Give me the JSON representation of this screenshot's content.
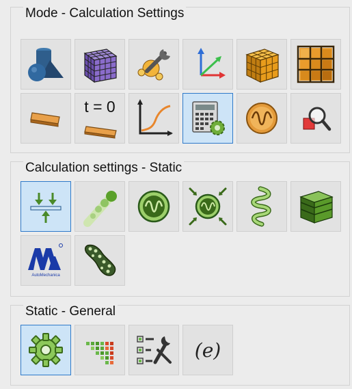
{
  "groups": [
    {
      "title": "Mode - Calculation Settings",
      "buttons": [
        {
          "name": "solid-shapes-icon"
        },
        {
          "name": "mesh-cube-icon"
        },
        {
          "name": "wrench-molecule-icon"
        },
        {
          "name": "xyz-axes-icon"
        },
        {
          "name": "grid-cube-icon"
        },
        {
          "name": "frame-grid-icon"
        },
        {
          "name": "beam-element-icon"
        },
        {
          "name": "time-zero-beam-icon",
          "label": "t = 0"
        },
        {
          "name": "response-curve-icon"
        },
        {
          "name": "calculator-gear-icon",
          "active": true
        },
        {
          "name": "wave-circle-icon"
        },
        {
          "name": "zoom-inspect-icon"
        }
      ]
    },
    {
      "title": "Calculation settings - Static",
      "buttons": [
        {
          "name": "load-support-icon",
          "active": true
        },
        {
          "name": "rod-spheres-icon"
        },
        {
          "name": "wave-disc-icon"
        },
        {
          "name": "compress-wave-icon"
        },
        {
          "name": "spiral-spring-icon"
        },
        {
          "name": "layered-box-icon"
        },
        {
          "name": "astm-logo-icon",
          "label": "AutoMechanica"
        },
        {
          "name": "perforated-part-icon"
        }
      ]
    },
    {
      "title": "Static - General",
      "buttons": [
        {
          "name": "settings-gear-icon",
          "active": true
        },
        {
          "name": "color-matrix-icon"
        },
        {
          "name": "list-tools-icon"
        },
        {
          "name": "expression-icon",
          "label": "(e)"
        }
      ]
    }
  ]
}
